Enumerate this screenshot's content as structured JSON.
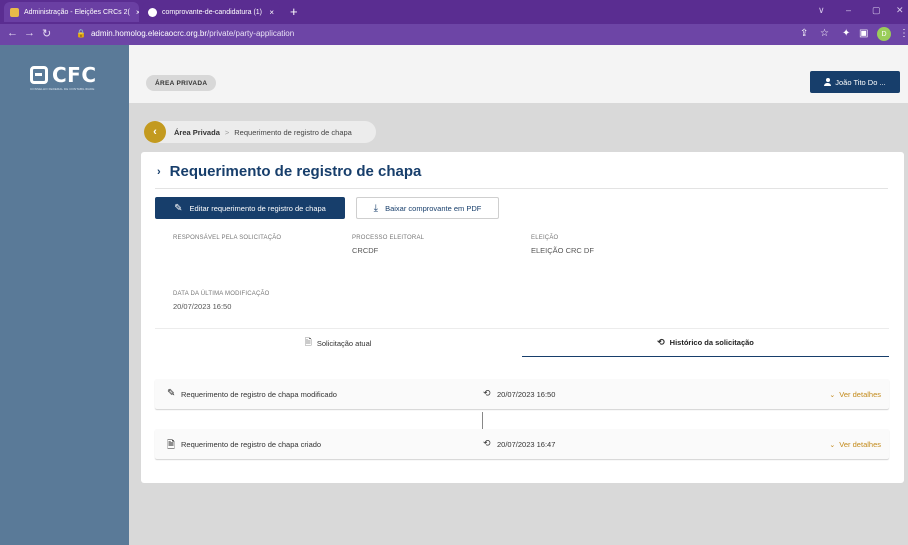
{
  "browser": {
    "tabs": [
      {
        "title": "Administração - Eleições CRCs 2(",
        "close": "×"
      },
      {
        "title": "comprovante-de-candidatura (1) ",
        "close": "×"
      }
    ],
    "new_tab": "+",
    "window_controls": {
      "collapse": "∨",
      "minimize": "–",
      "maximize": "▢",
      "close": "✕"
    },
    "url_host": "admin.homolog.eleicaocrc.org.br",
    "url_path": "/private/party-application",
    "profile_initial": "D"
  },
  "sidebar": {
    "logo_text": "CFC",
    "logo_subtitle": "CONSELHO FEDERAL DE CONTABILIDADE"
  },
  "topbar": {
    "area_badge": "ÁREA PRIVADA",
    "user_button": "João Tito Do ..."
  },
  "breadcrumb": {
    "back_icon": "‹",
    "root": "Área Privada",
    "separator": ">",
    "current": "Requerimento de registro de chapa"
  },
  "card": {
    "title": "Requerimento de registro de chapa",
    "actions": {
      "edit_label": "Editar requerimento de registro de chapa",
      "pdf_label": "Baixar comprovante em PDF"
    },
    "fields": {
      "responsavel_label": "RESPONSÁVEL PELA SOLICITAÇÃO",
      "processo_label": "PROCESSO ELEITORAL",
      "processo_value": "CRCDF",
      "eleicao_label": "ELEIÇÃO",
      "eleicao_value": "ELEIÇÃO CRC DF",
      "modificacao_label": "DATA DA ÚLTIMA MODIFICAÇÃO",
      "modificacao_value": "20/07/2023 16:50"
    },
    "tabs": [
      {
        "label": "Solicitação atual"
      },
      {
        "label": "Histórico da solicitação",
        "active": true
      }
    ],
    "history": [
      {
        "text": "Requerimento de registro de chapa modificado",
        "date": "20/07/2023 16:50",
        "details": "Ver detalhes",
        "icon": "pencil-icon"
      },
      {
        "text": "Requerimento de registro de chapa criado",
        "date": "20/07/2023 16:47",
        "details": "Ver detalhes",
        "icon": "document-icon"
      }
    ]
  },
  "colors": {
    "chrome": "#5a2d91",
    "sidebar": "#5a7a98",
    "primary": "#173e6b",
    "accent": "#c39a1f"
  }
}
